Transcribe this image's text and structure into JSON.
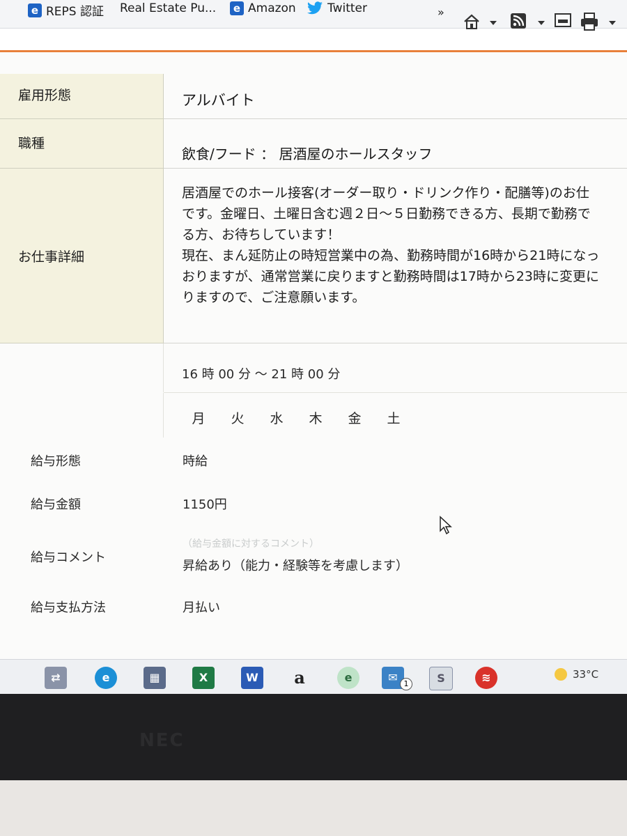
{
  "bookmarks": [
    {
      "label": "REPS 認証"
    },
    {
      "label": "Real Estate Pu..."
    },
    {
      "label": "Amazon"
    },
    {
      "label": "Twitter"
    }
  ],
  "toolbar": {
    "overflow": "»",
    "icons": [
      "home-icon",
      "feed-icon",
      "page-icon",
      "print-icon"
    ]
  },
  "job": {
    "employment_type": {
      "label": "雇用形態",
      "value": "アルバイト"
    },
    "occupation": {
      "label": "職種",
      "value": "飲食/フード ： 居酒屋のホールスタッフ"
    },
    "details": {
      "label": "お仕事詳細",
      "text": "居酒屋でのホール接客(オーダー取り・ドリンク作り・配膳等)のお仕\nです。金曜日、土曜日含む週２日～５日勤務できる方、長期で勤務で\nる方、お待ちしています！\n現在、まん延防止の時短営業中の為、勤務時間が16時から21時になっ\nおりますが、通常営業に戻りますと勤務時間は17時から23時に変更に\nりますので、ご注意願います。"
    },
    "hours": "16 時 00 分  ～  21 時 00 分",
    "days": [
      "月",
      "火",
      "水",
      "木",
      "金",
      "土"
    ]
  },
  "salary": {
    "type": {
      "label": "給与形態",
      "value": "時給"
    },
    "amount": {
      "label": "給与金額",
      "value": "1150円"
    },
    "comment": {
      "label": "給与コメント",
      "placeholder": "（給与金額に対するコメント）",
      "value": "昇給あり（能力・経験等を考慮します）"
    },
    "payment": {
      "label": "給与支払方法",
      "value": "月払い"
    }
  },
  "taskbar": {
    "apps": [
      "task-view-icon",
      "edge-icon",
      "store-icon",
      "excel-icon",
      "word-icon",
      "amazon-icon",
      "ie-icon",
      "mail-icon",
      "app-icon",
      "app-red-icon"
    ],
    "mail_badge": "1",
    "temperature": "33°C"
  },
  "monitor": {
    "brand": "NEC"
  },
  "colors": {
    "label_bg": "#f4f2df",
    "accent_rule": "#e8803a"
  }
}
